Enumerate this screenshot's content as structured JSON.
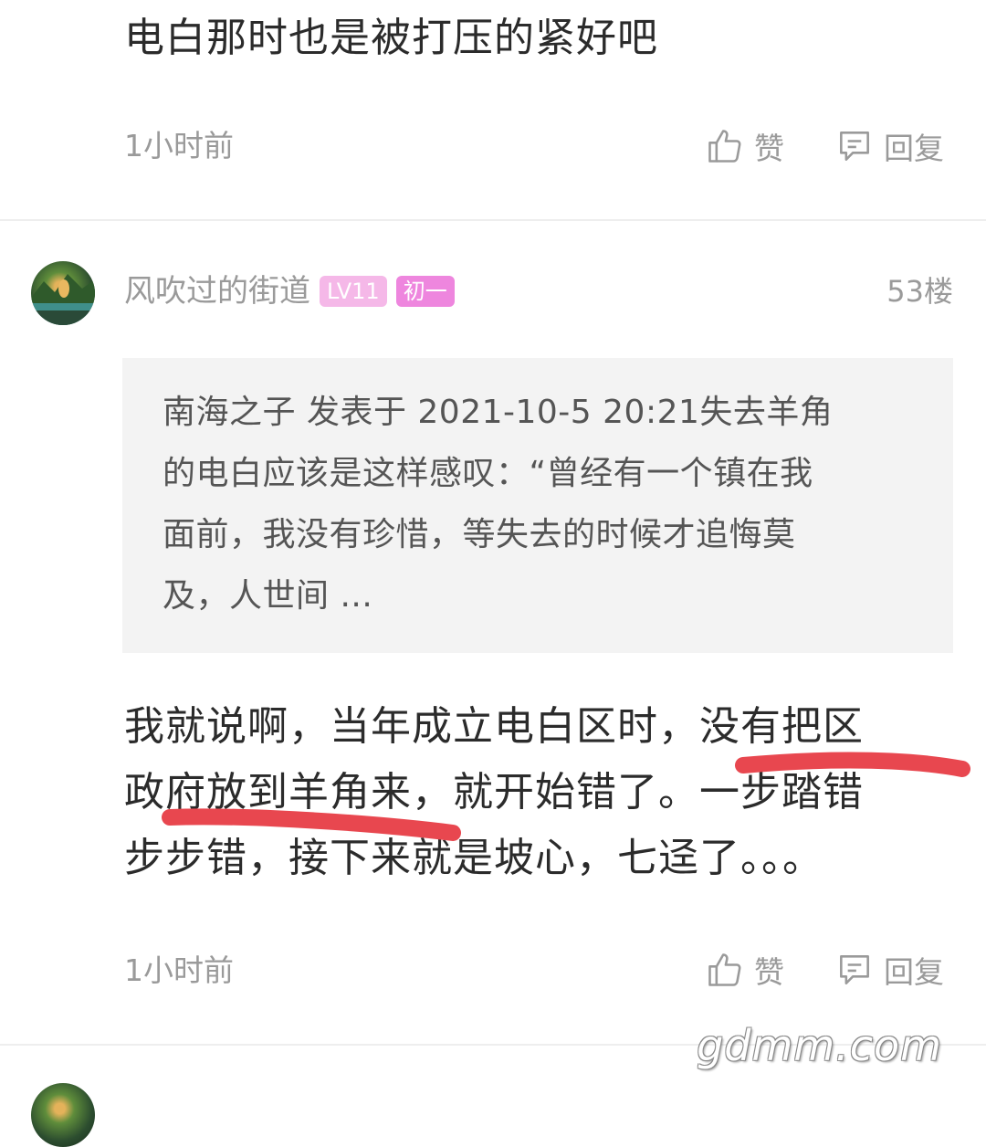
{
  "prev_comment": {
    "text": "电白那时也是被打压的紧好吧",
    "time": "1小时前",
    "like_label": "赞",
    "reply_label": "回复"
  },
  "comment": {
    "username": "风吹过的街道",
    "level_badge": "LV11",
    "rank_badge": "初一",
    "floor": "53楼",
    "quote": {
      "line1": "南海之子 发表于 2021-10-5 20:21失去羊角",
      "line2": "的电白应该是这样感叹：“曾经有一个镇在我",
      "line3": "面前，我没有珍惜，等失去的时候才追悔莫",
      "line4": "及，人世间 ..."
    },
    "body": {
      "line1": "我就说啊，当年成立电白区时，没有把区",
      "line2": "政府放到羊角来，就开始错了。一步踏错",
      "line3": "步步错，接下来就是坡心，七迳了。。。"
    },
    "time": "1小时前",
    "like_label": "赞",
    "reply_label": "回复"
  },
  "watermark": "gdmm.com",
  "colors": {
    "text": "#2b2b2b",
    "meta": "#9a9a9a",
    "quote_bg": "#f3f3f3",
    "badge_lv": "#f5b8e8",
    "badge_rank": "#ee86de",
    "underline_marker": "#e8474f"
  },
  "icons": [
    "thumbs-up-icon",
    "reply-icon",
    "avatar"
  ]
}
